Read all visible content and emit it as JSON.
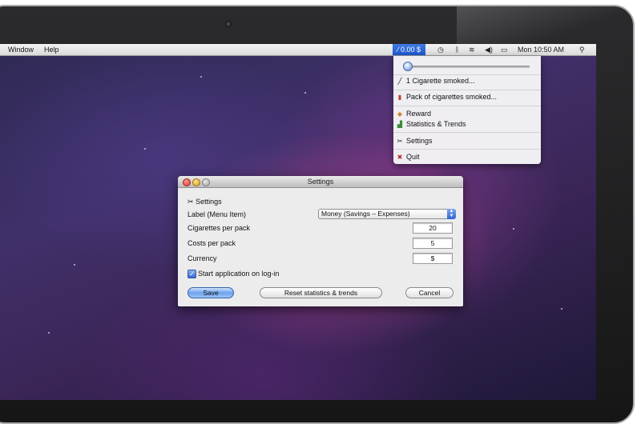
{
  "menubar": {
    "items": [
      "Window",
      "Help"
    ],
    "status_value": "0.00 $",
    "clock": "Mon 10:50 AM"
  },
  "status_menu": {
    "slider_value": 0,
    "items": [
      {
        "icon": "cigarette-icon",
        "label": "1 Cigarette smoked..."
      },
      {
        "icon": "cigarette-pack-icon",
        "label": "Pack of cigarettes smoked..."
      },
      {
        "icon": "reward-icon",
        "label": "Reward"
      },
      {
        "icon": "chart-icon",
        "label": "Statistics & Trends"
      },
      {
        "icon": "settings-icon",
        "label": "Settings"
      },
      {
        "icon": "quit-icon",
        "label": "Quit"
      }
    ]
  },
  "settings_window": {
    "title": "Settings",
    "header": "Settings",
    "label_menu_item": "Label (Menu Item)",
    "label_select_value": "Money (Savings – Expenses)",
    "cigarettes_per_pack_label": "Cigarettes per pack",
    "cigarettes_per_pack_value": "20",
    "costs_per_pack_label": "Costs per pack",
    "costs_per_pack_value": "5",
    "currency_label": "Currency",
    "currency_value": "$",
    "start_on_login_label": "Start application on log-in",
    "start_on_login_checked": true,
    "save_label": "Save",
    "reset_label": "Reset statistics & trends",
    "cancel_label": "Cancel"
  },
  "colors": {
    "accent": "#2f63d5",
    "menu_highlight": "#1f55cc"
  }
}
